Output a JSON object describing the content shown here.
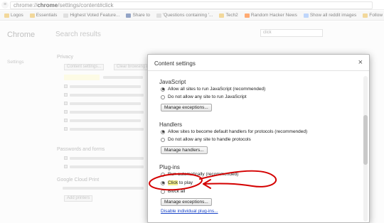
{
  "browser": {
    "url_prefix": "chrome://",
    "url_host": "chrome",
    "url_path": "/settings/content#click",
    "bookmarks": [
      {
        "label": "Logos",
        "color": "#e8b84a"
      },
      {
        "label": "Essentials",
        "color": "#e8b84a"
      },
      {
        "label": "Highest Voted Feature...",
        "color": "#c5c5c5"
      },
      {
        "label": "Share to",
        "color": "#3b5998"
      },
      {
        "label": "'Questions containing '...",
        "color": "#c5c5c5"
      },
      {
        "label": "Tech2",
        "color": "#e8b84a"
      },
      {
        "label": "Random Hacker News",
        "color": "#ff6600"
      },
      {
        "label": "Show all reddit images",
        "color": "#8ab4f8"
      },
      {
        "label": "Follow up",
        "color": "#e8b84a"
      }
    ]
  },
  "page": {
    "sidebar_title": "Chrome",
    "sidebar_item": "Settings",
    "main_title": "Search results",
    "search_value": "click",
    "bg_headings": [
      "Privacy",
      "Passwords and forms",
      "Google Cloud Print"
    ],
    "bg_buttons": [
      "Content settings...",
      "Clear browsing data...",
      "Add printers"
    ]
  },
  "dialog": {
    "title": "Content settings",
    "close": "×",
    "sections": {
      "javascript": {
        "title": "JavaScript",
        "options": [
          "Allow all sites to run JavaScript (recommended)",
          "Do not allow any site to run JavaScript"
        ],
        "button": "Manage exceptions..."
      },
      "handlers": {
        "title": "Handlers",
        "options": [
          "Allow sites to become default handlers for protocols (recommended)",
          "Do not allow any site to handle protocols"
        ],
        "button": "Manage handlers..."
      },
      "plugins": {
        "title": "Plug-ins",
        "options": [
          "Run automatically (recommended)",
          "Click",
          "to play",
          "Block all"
        ],
        "button": "Manage exceptions...",
        "link": "Disable individual plug-ins..."
      }
    }
  },
  "annotation_color": "#d40000"
}
